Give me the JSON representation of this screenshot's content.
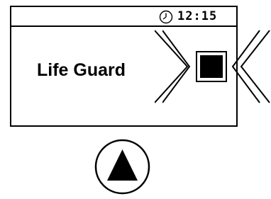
{
  "status_bar": {
    "clock_icon": "clock-icon",
    "time": "12:15"
  },
  "display": {
    "mode_label": "Life Guard",
    "indicator_icon": "stop-square-icon",
    "left_chevrons_icon": "double-chevron-right-icon",
    "right_chevrons_icon": "double-chevron-left-icon"
  },
  "controls": {
    "up_button_icon": "triangle-up-icon"
  },
  "colors": {
    "foreground": "#000000",
    "background": "#ffffff"
  }
}
